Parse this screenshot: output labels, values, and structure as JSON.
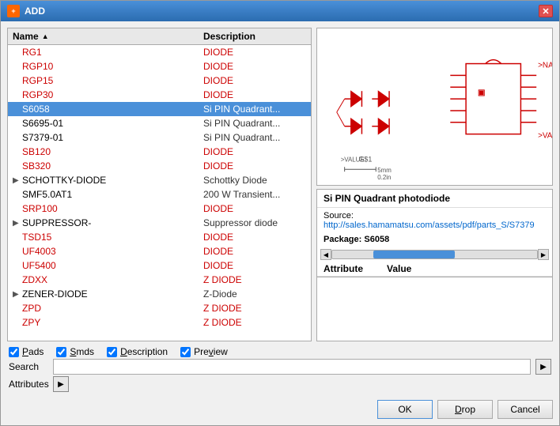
{
  "window": {
    "title": "ADD",
    "icon": "+"
  },
  "toolbar": {
    "close_label": "✕"
  },
  "list": {
    "col_name": "Name",
    "col_desc": "Description",
    "sort_indicator": "▲",
    "items": [
      {
        "name": "RG1",
        "desc": "DIODE",
        "red": true,
        "expandable": false,
        "selected": false
      },
      {
        "name": "RGP10",
        "desc": "DIODE",
        "red": true,
        "expandable": false,
        "selected": false
      },
      {
        "name": "RGP15",
        "desc": "DIODE",
        "red": true,
        "expandable": false,
        "selected": false
      },
      {
        "name": "RGP30",
        "desc": "DIODE",
        "red": true,
        "expandable": false,
        "selected": false
      },
      {
        "name": "S6058",
        "desc": "Si PIN Quadrant...",
        "red": false,
        "expandable": false,
        "selected": true
      },
      {
        "name": "S6695-01",
        "desc": "Si PIN Quadrant...",
        "red": false,
        "expandable": false,
        "selected": false
      },
      {
        "name": "S7379-01",
        "desc": "Si PIN Quadrant...",
        "red": false,
        "expandable": false,
        "selected": false
      },
      {
        "name": "SB120",
        "desc": "DIODE",
        "red": true,
        "expandable": false,
        "selected": false
      },
      {
        "name": "SB320",
        "desc": "DIODE",
        "red": true,
        "expandable": false,
        "selected": false
      },
      {
        "name": "SCHOTTKY-DIODE",
        "desc": "Schottky Diode",
        "red": false,
        "expandable": true,
        "selected": false
      },
      {
        "name": "SMF5.0AT1",
        "desc": "200 W Transient...",
        "red": false,
        "expandable": false,
        "selected": false
      },
      {
        "name": "SRP100",
        "desc": "DIODE",
        "red": true,
        "expandable": false,
        "selected": false
      },
      {
        "name": "SUPPRESSOR-",
        "desc": "Suppressor diode",
        "red": false,
        "expandable": true,
        "selected": false
      },
      {
        "name": "TSD15",
        "desc": "DIODE",
        "red": true,
        "expandable": false,
        "selected": false
      },
      {
        "name": "UF4003",
        "desc": "DIODE",
        "red": true,
        "expandable": false,
        "selected": false
      },
      {
        "name": "UF5400",
        "desc": "DIODE",
        "red": true,
        "expandable": false,
        "selected": false
      },
      {
        "name": "ZDXX",
        "desc": "Z DIODE",
        "red": true,
        "expandable": false,
        "selected": false
      },
      {
        "name": "ZENER-DIODE",
        "desc": "Z-Diode",
        "red": false,
        "expandable": true,
        "selected": false
      },
      {
        "name": "ZPD",
        "desc": "Z DIODE",
        "red": true,
        "expandable": false,
        "selected": false
      },
      {
        "name": "ZPY",
        "desc": "Z DIODE",
        "red": true,
        "expandable": false,
        "selected": false
      }
    ]
  },
  "checkboxes": {
    "pads": {
      "label": "Pads",
      "checked": true
    },
    "smds": {
      "label": "Smds",
      "checked": true
    },
    "description": {
      "label": "Description",
      "checked": true
    },
    "preview": {
      "label": "Preview",
      "checked": true
    }
  },
  "search": {
    "label": "Search",
    "value": "",
    "placeholder": ""
  },
  "attributes": {
    "label": "Attributes"
  },
  "info": {
    "title": "Si PIN Quadrant photodiode",
    "source_label": "Source:",
    "source_url": "http://sales.hamamatsu.com/assets/pdf/parts_S/S7379",
    "package_label": "Package:",
    "package_value": "S6058"
  },
  "attr_table": {
    "col_attribute": "Attribute",
    "col_value": "Value"
  },
  "buttons": {
    "ok": "OK",
    "drop": "Drop",
    "cancel": "Cancel"
  },
  "preview": {
    "scale_label": "5mm",
    "scale_sub": "0.2in"
  }
}
